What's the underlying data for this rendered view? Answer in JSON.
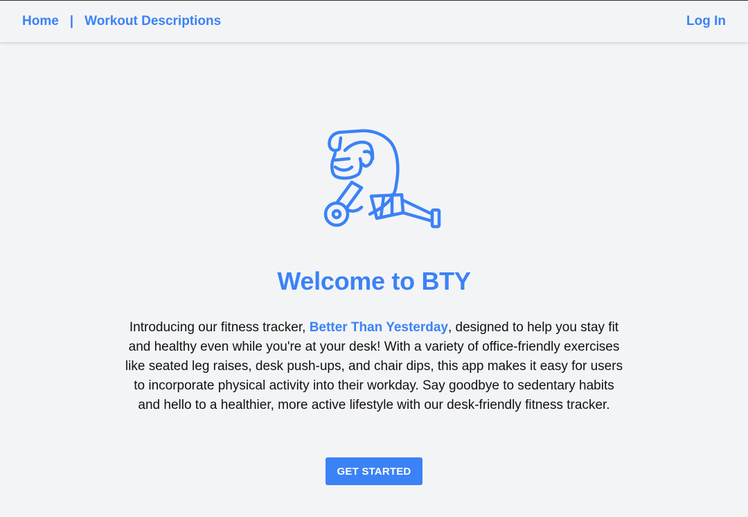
{
  "nav": {
    "home_label": "Home",
    "separator": "|",
    "workouts_label": "Workout Descriptions",
    "login_label": "Log In"
  },
  "hero": {
    "logo_icon": "pushup-person-icon",
    "title": "Welcome to BTY",
    "intro_before": "Introducing our fitness tracker, ",
    "brand_name": "Better Than Yesterday",
    "intro_after": ", designed to help you stay fit and healthy even while you're at your desk! With a variety of office-friendly exercises like seated leg raises, desk push-ups, and chair dips, this app makes it easy for users to incorporate physical activity into their workday. Say goodbye to sedentary habits and hello to a healthier, more active lifestyle with our desk-friendly fitness tracker.",
    "cta_label": "GET STARTED"
  },
  "colors": {
    "accent": "#3b82f6",
    "background": "#f3f4f6",
    "text": "#111111"
  }
}
